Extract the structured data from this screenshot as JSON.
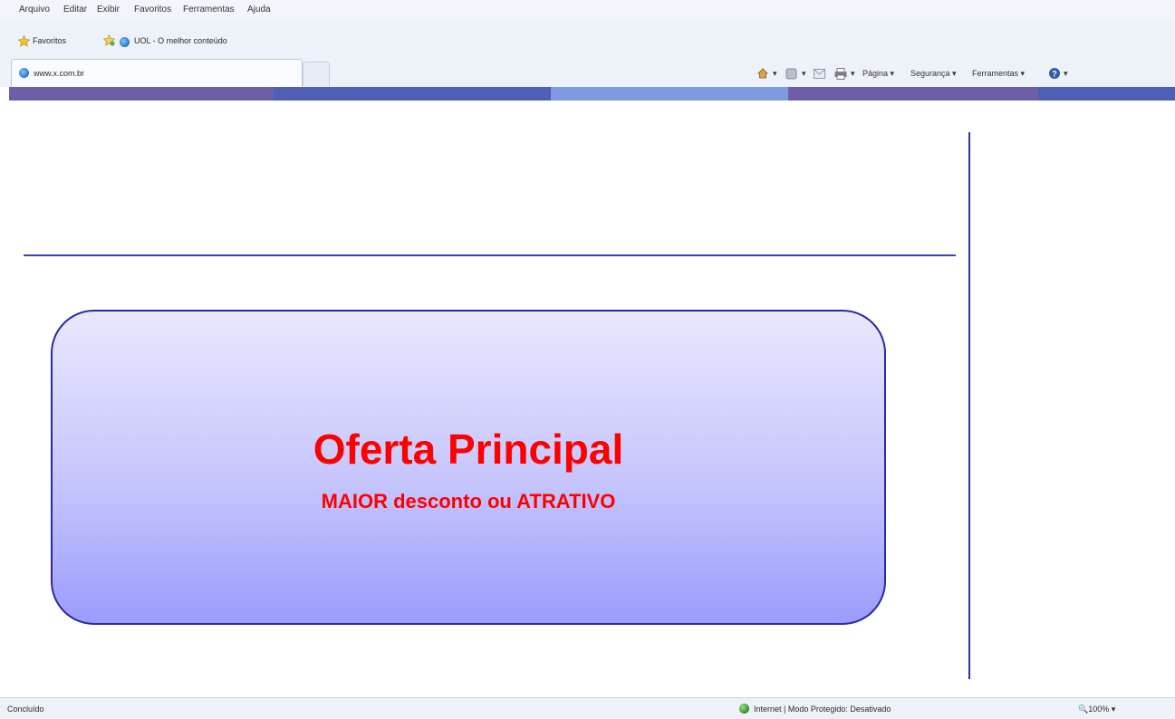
{
  "menu": {
    "items": [
      "Arquivo",
      "Editar",
      "Exibir",
      "Favoritos",
      "Ferramentas",
      "Ajuda"
    ]
  },
  "favorites_bar": {
    "favorites_label": "Favoritos",
    "link_label": "UOL - O melhor conteúdo"
  },
  "tab": {
    "title": "www.x.com.br"
  },
  "command_bar": {
    "page_label": "Página",
    "security_label": "Segurança",
    "tools_label": "Ferramentas"
  },
  "stripe_colors": [
    "#6d5ea7",
    "#4e5fb4",
    "#7f9ae0",
    "#6d5ea7",
    "#4e5fb4"
  ],
  "offer": {
    "title": "Oferta Principal",
    "subtitle": "MAIOR desconto ou ATRATIVO"
  },
  "status": {
    "left_text": "Concluído",
    "zone_text": "Internet | Modo Protegido: Desativado",
    "zoom_text": "100%"
  }
}
